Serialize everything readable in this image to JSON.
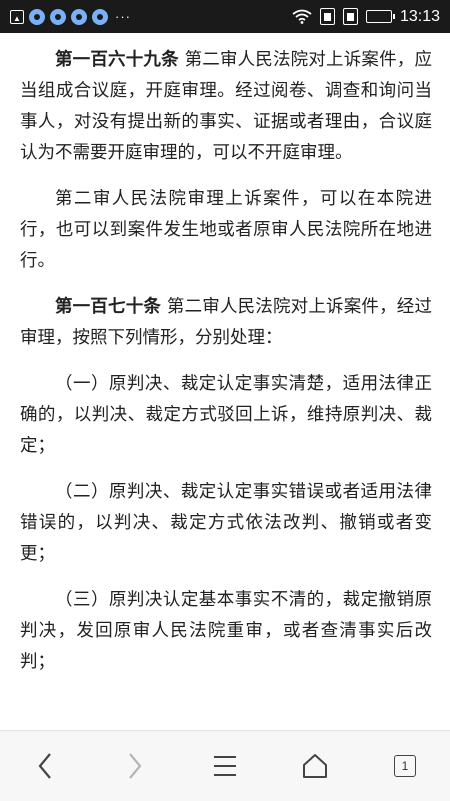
{
  "status_bar": {
    "time": "13:13",
    "more_indicator": "···",
    "icons": [
      "app-icon",
      "chat-icon",
      "chat-icon",
      "chat-icon",
      "chat-icon",
      "wifi-icon",
      "sim-icon",
      "sim-icon",
      "battery-icon"
    ]
  },
  "article": {
    "paragraphs": [
      {
        "heading": "第一百六十九条",
        "text": " 第二审人民法院对上诉案件，应当组成合议庭，开庭审理。经过阅卷、调查和询问当事人，对没有提出新的事实、证据或者理由，合议庭认为不需要开庭审理的，可以不开庭审理。"
      },
      {
        "heading": "",
        "text": "第二审人民法院审理上诉案件，可以在本院进行，也可以到案件发生地或者原审人民法院所在地进行。"
      },
      {
        "heading": "第一百七十条",
        "text": " 第二审人民法院对上诉案件，经过审理，按照下列情形，分别处理："
      },
      {
        "heading": "",
        "text": "（一）原判决、裁定认定事实清楚，适用法律正确的，以判决、裁定方式驳回上诉，维持原判决、裁定；"
      },
      {
        "heading": "",
        "text": "（二）原判决、裁定认定事实错误或者适用法律错误的，以判决、裁定方式依法改判、撤销或者变更；"
      },
      {
        "heading": "",
        "text": "（三）原判决认定基本事实不清的，裁定撤销原判决，发回原审人民法院重审，或者查清事实后改判；"
      }
    ]
  },
  "bottom_nav": {
    "back_icon": "chevron-left-icon",
    "forward_icon": "chevron-right-icon",
    "menu_icon": "menu-icon",
    "home_icon": "home-icon",
    "tab_count": "1"
  }
}
